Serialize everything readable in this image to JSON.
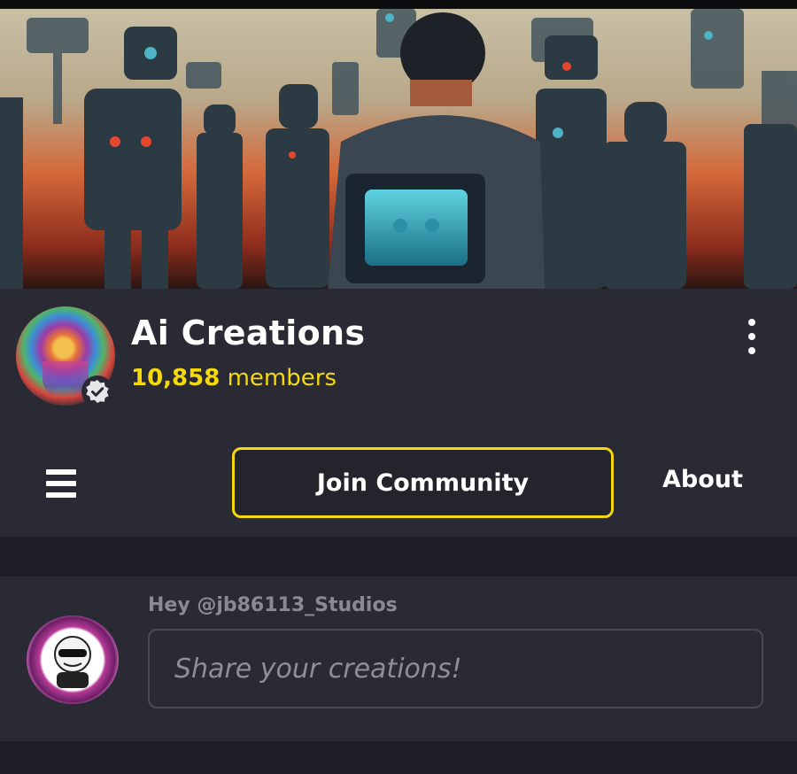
{
  "community": {
    "name": "Ai Creations",
    "member_count": "10,858",
    "member_suffix": " members"
  },
  "actions": {
    "join_label": "Join Community",
    "about_label": "About"
  },
  "composer": {
    "greeting": "Hey @jb86113_Studios",
    "placeholder": "Share your creations!"
  },
  "colors": {
    "accent": "#f5d90a",
    "background": "#2a2a35",
    "page_bg": "#1e1e26"
  },
  "icons": {
    "menu": "hamburger-icon",
    "more": "kebab-menu-icon",
    "verified": "verified-badge-icon"
  }
}
